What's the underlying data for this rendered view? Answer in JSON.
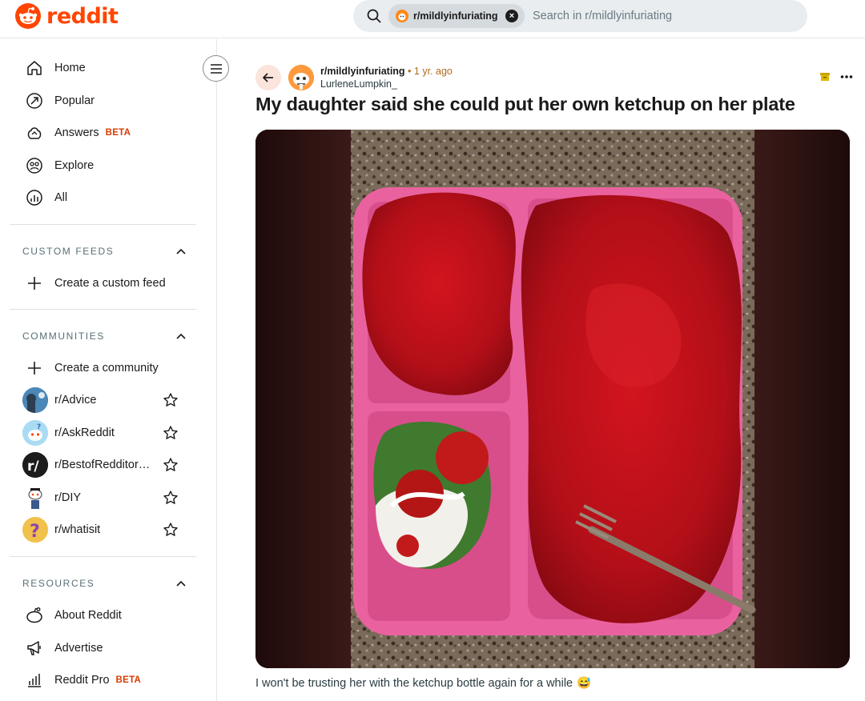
{
  "header": {
    "brand": "reddit",
    "search_chip": "r/mildlyinfuriating",
    "search_placeholder": "Search in r/mildlyinfuriating"
  },
  "sidebar": {
    "nav": [
      {
        "label": "Home",
        "icon": "home-icon"
      },
      {
        "label": "Popular",
        "icon": "popular-icon"
      },
      {
        "label": "Answers",
        "icon": "answers-icon",
        "badge": "BETA"
      },
      {
        "label": "Explore",
        "icon": "explore-icon"
      },
      {
        "label": "All",
        "icon": "all-icon"
      }
    ],
    "custom_feeds": {
      "title": "CUSTOM FEEDS",
      "create_label": "Create a custom feed"
    },
    "communities": {
      "title": "COMMUNITIES",
      "create_label": "Create a community",
      "items": [
        {
          "label": "r/Advice"
        },
        {
          "label": "r/AskReddit"
        },
        {
          "label": "r/BestofRedditorUpdates"
        },
        {
          "label": "r/DIY"
        },
        {
          "label": "r/whatisit"
        }
      ]
    },
    "resources": {
      "title": "RESOURCES",
      "items": [
        {
          "label": "About Reddit",
          "icon": "reddit-alien-icon"
        },
        {
          "label": "Advertise",
          "icon": "megaphone-icon"
        },
        {
          "label": "Reddit Pro",
          "icon": "bar-chart-icon",
          "badge": "BETA"
        }
      ]
    }
  },
  "post": {
    "subreddit": "r/mildlyinfuriating",
    "time": "• 1 yr. ago",
    "author": "LurleneLumpkin_",
    "title": "My daughter said she could put her own ketchup on her plate",
    "caption": "I won't be trusting her with the ketchup bottle again for a while",
    "caption_emoji": "😅"
  },
  "colors": {
    "brand": "#ff4500",
    "beta": "#d93a00",
    "plate": "#e9629f",
    "ketchup": "#c0121c"
  }
}
